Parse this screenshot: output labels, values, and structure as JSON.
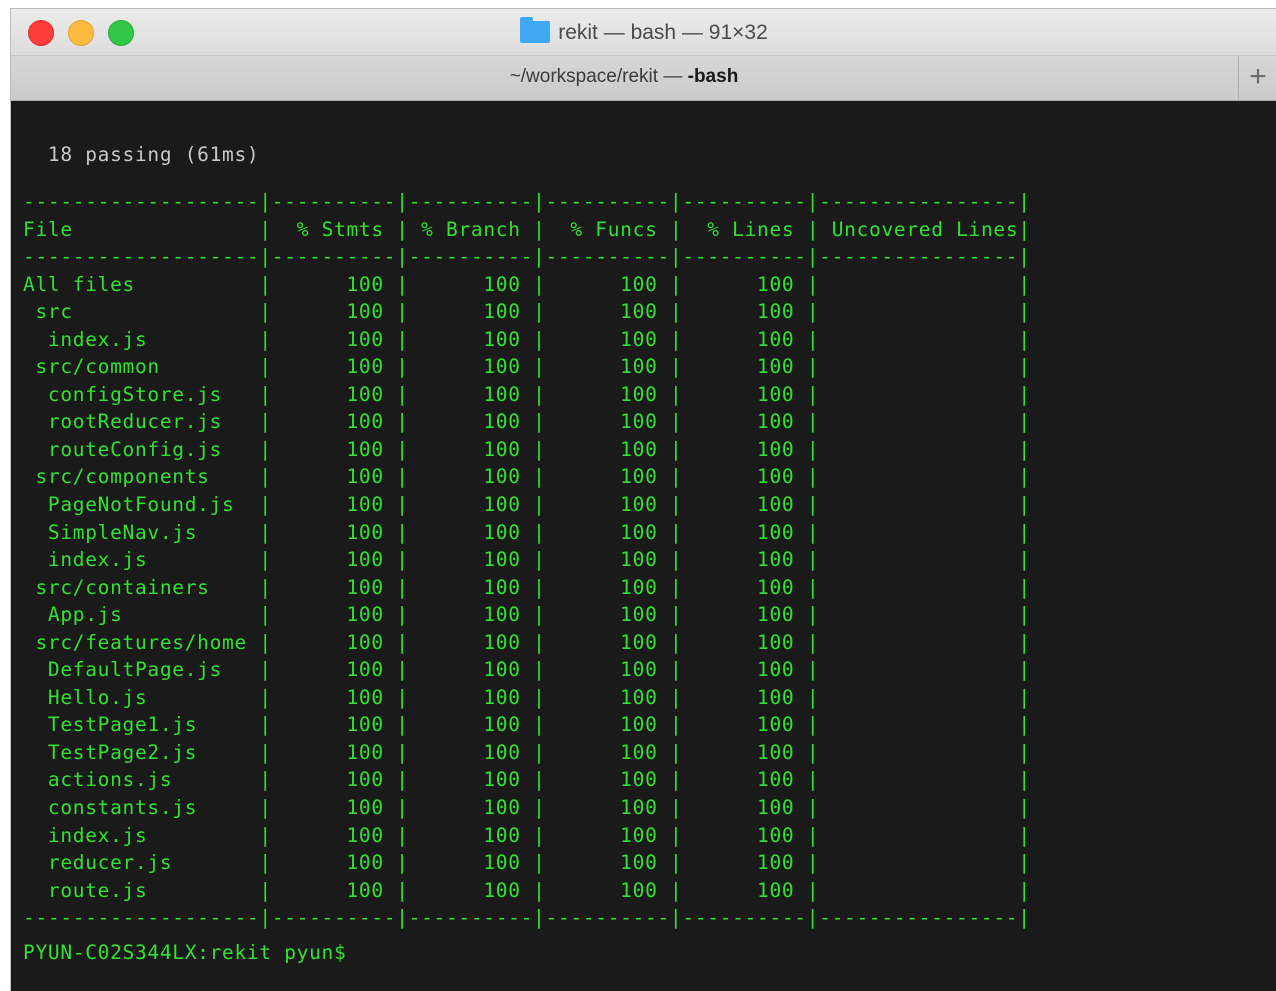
{
  "window": {
    "title_dir": "rekit",
    "title_proc": "bash",
    "title_size": "91×32",
    "tab_path": "~/workspace/rekit",
    "tab_proc": "-bash",
    "new_tab_label": "+"
  },
  "terminal": {
    "passing_line": "  18 passing (61ms)",
    "separator": "-------------------|----------|----------|----------|----------|----------------|",
    "headers": [
      "File",
      "% Stmts",
      "% Branch",
      "% Funcs",
      "% Lines",
      "Uncovered Lines"
    ],
    "rows": [
      [
        "All files",
        "100",
        "100",
        "100",
        "100",
        ""
      ],
      [
        " src",
        "100",
        "100",
        "100",
        "100",
        ""
      ],
      [
        "  index.js",
        "100",
        "100",
        "100",
        "100",
        ""
      ],
      [
        " src/common",
        "100",
        "100",
        "100",
        "100",
        ""
      ],
      [
        "  configStore.js",
        "100",
        "100",
        "100",
        "100",
        ""
      ],
      [
        "  rootReducer.js",
        "100",
        "100",
        "100",
        "100",
        ""
      ],
      [
        "  routeConfig.js",
        "100",
        "100",
        "100",
        "100",
        ""
      ],
      [
        " src/components",
        "100",
        "100",
        "100",
        "100",
        ""
      ],
      [
        "  PageNotFound.js",
        "100",
        "100",
        "100",
        "100",
        ""
      ],
      [
        "  SimpleNav.js",
        "100",
        "100",
        "100",
        "100",
        ""
      ],
      [
        "  index.js",
        "100",
        "100",
        "100",
        "100",
        ""
      ],
      [
        " src/containers",
        "100",
        "100",
        "100",
        "100",
        ""
      ],
      [
        "  App.js",
        "100",
        "100",
        "100",
        "100",
        ""
      ],
      [
        " src/features/home",
        "100",
        "100",
        "100",
        "100",
        ""
      ],
      [
        "  DefaultPage.js",
        "100",
        "100",
        "100",
        "100",
        ""
      ],
      [
        "  Hello.js",
        "100",
        "100",
        "100",
        "100",
        ""
      ],
      [
        "  TestPage1.js",
        "100",
        "100",
        "100",
        "100",
        ""
      ],
      [
        "  TestPage2.js",
        "100",
        "100",
        "100",
        "100",
        ""
      ],
      [
        "  actions.js",
        "100",
        "100",
        "100",
        "100",
        ""
      ],
      [
        "  constants.js",
        "100",
        "100",
        "100",
        "100",
        ""
      ],
      [
        "  index.js",
        "100",
        "100",
        "100",
        "100",
        ""
      ],
      [
        "  reducer.js",
        "100",
        "100",
        "100",
        "100",
        ""
      ],
      [
        "  route.js",
        "100",
        "100",
        "100",
        "100",
        ""
      ]
    ],
    "prompt": "PYUN-C02S344LX:rekit pyun$ "
  },
  "colors": {
    "terminal_bg": "#1a1a1a",
    "terminal_fg": "#33e033",
    "traffic_close": "#fc3d39",
    "traffic_min": "#fdbc40",
    "traffic_max": "#33c748",
    "folder_icon": "#3fa9f5"
  }
}
